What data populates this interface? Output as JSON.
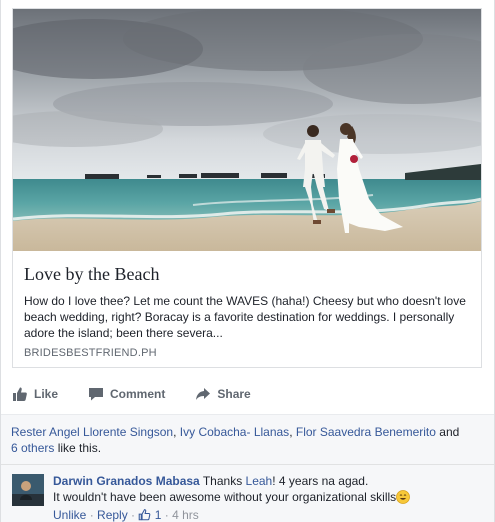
{
  "card": {
    "title": "Love by the Beach",
    "description": "How do I love thee? Let me count the WAVES (haha!) Cheesy but who doesn't love beach wedding, right? Boracay is a favorite destination for weddings. I personally adore the island; been there severa...",
    "domain": "BRIDESBESTFRIEND.PH"
  },
  "actions": {
    "like": "Like",
    "comment": "Comment",
    "share": "Share"
  },
  "likes": {
    "name1": "Rester Angel Llorente Singson",
    "sep1": ", ",
    "name2": "Ivy Cobacha- Llanas",
    "sep2": ", ",
    "name3": "Flor Saavedra Benemerito",
    "and": " and ",
    "others": "6 others",
    "suffix": " like this."
  },
  "comment": {
    "author": "Darwin Granados Mabasa",
    "text_before": " Thanks ",
    "mention": "Leah",
    "text_after": "! 4 years na agad.",
    "line2": "It wouldn't have been awesome without your organizational skills",
    "unlike": "Unlike",
    "sep": " · ",
    "reply": "Reply",
    "like_count": "1",
    "time": "4 hrs"
  },
  "icons": {
    "like": "thumbs-up-icon",
    "comment": "speech-bubble-icon",
    "share": "share-arrow-icon",
    "emoji": "smiling-face-emoji"
  },
  "colors": {
    "link": "#365899",
    "muted": "#606770",
    "feedback_bg": "#f6f7f9"
  }
}
